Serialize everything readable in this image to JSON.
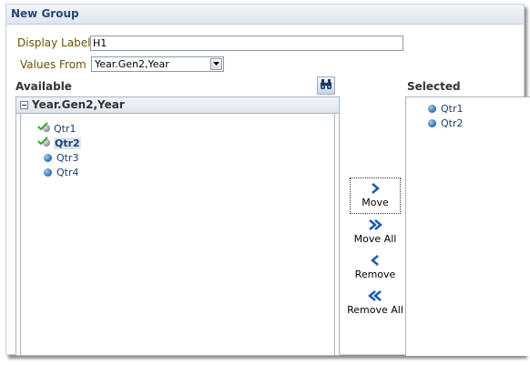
{
  "dialog": {
    "title": "New Group"
  },
  "form": {
    "display_label_label": "Display Label",
    "display_label_value": "H1",
    "values_from_label": "Values From",
    "values_from_value": "Year.Gen2,Year"
  },
  "available": {
    "title": "Available",
    "tree_header": "Year.Gen2,Year",
    "items": [
      {
        "label": "Qtr1",
        "icon": "checked-bullet-icon",
        "selected": false
      },
      {
        "label": "Qtr2",
        "icon": "checked-bullet-icon",
        "selected": true
      },
      {
        "label": "Qtr3",
        "icon": "bullet-icon",
        "selected": false
      },
      {
        "label": "Qtr4",
        "icon": "bullet-icon",
        "selected": false
      }
    ]
  },
  "selected": {
    "title": "Selected",
    "items": [
      {
        "label": "Qtr1",
        "icon": "bullet-icon"
      },
      {
        "label": "Qtr2",
        "icon": "bullet-icon"
      }
    ]
  },
  "actions": {
    "move": "Move",
    "move_all": "Move All",
    "remove": "Remove",
    "remove_all": "Remove All"
  },
  "colors": {
    "accent": "#1e5aa8",
    "label": "#6a5200",
    "title": "#264a72"
  }
}
